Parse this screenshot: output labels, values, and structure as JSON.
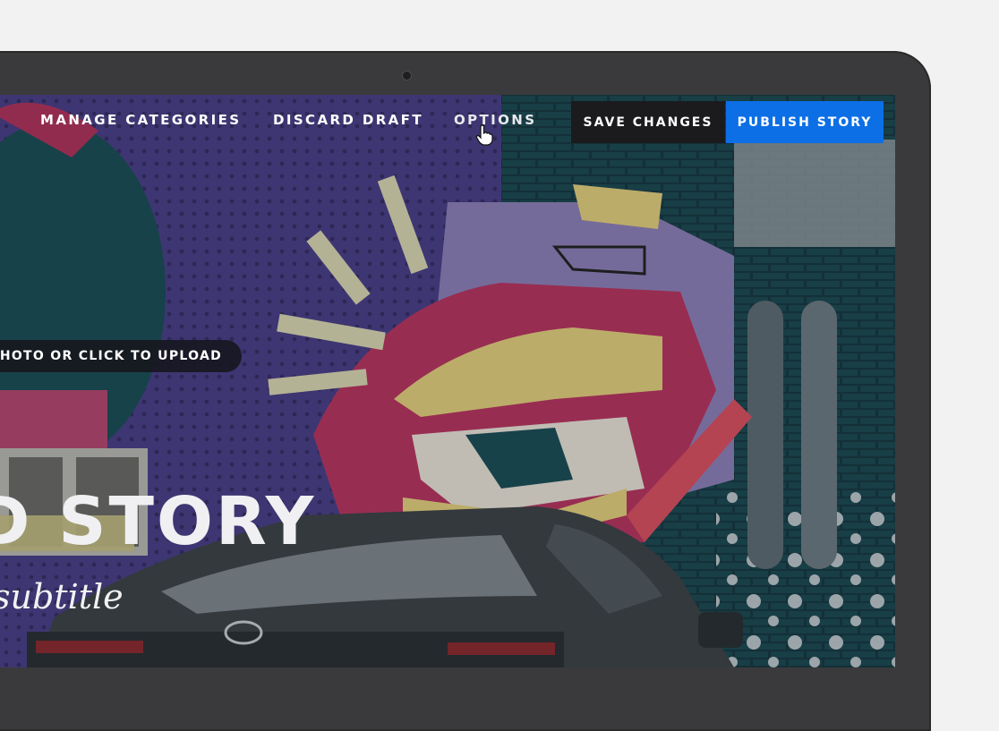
{
  "toolbar": {
    "separator": "/",
    "manage_categories": "MANAGE CATEGORIES",
    "discard_draft": "DISCARD DRAFT",
    "options": "OPTIONS",
    "save_changes": "SAVE CHANGES",
    "publish_story": "PUBLISH STORY"
  },
  "hero": {
    "upload_hint": "PHOTO OR CLICK TO UPLOAD",
    "title": "D STORY",
    "subtitle": "subtitle"
  },
  "colors": {
    "publish_button": "#0c6fe6",
    "save_button": "#1b1b1d",
    "bezel": "#3a3a3c",
    "page_background": "#f2f2f2"
  },
  "icons": {
    "cursor": "hand-pointer-icon",
    "camera": "camera-dot"
  }
}
